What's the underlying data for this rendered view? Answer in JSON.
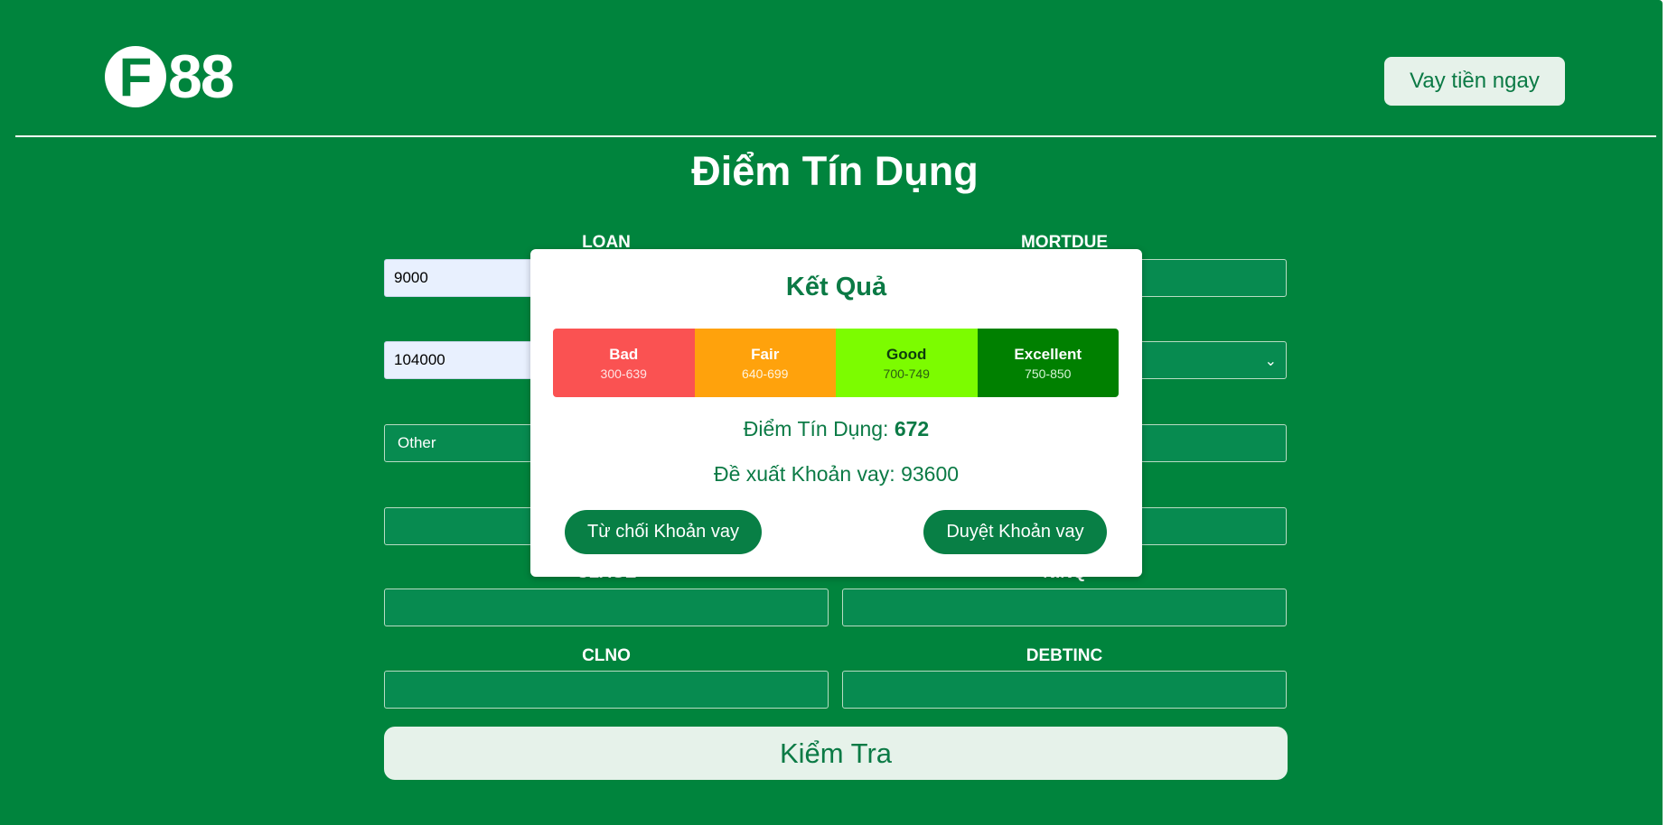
{
  "header": {
    "logo_letter": "F",
    "logo_number": "88",
    "cta_label": "Vay tiền ngay"
  },
  "page_title": "Điểm Tín Dụng",
  "form": {
    "fields": [
      {
        "label": "LOAN",
        "value": "9000"
      },
      {
        "label": "MORTDUE",
        "value": ""
      },
      {
        "label": "",
        "value": "104000"
      },
      {
        "label": "",
        "value": ""
      },
      {
        "label": "",
        "value": "Other"
      },
      {
        "label": "",
        "value": ""
      },
      {
        "label": "",
        "value": ""
      },
      {
        "label": "",
        "value": ""
      },
      {
        "label": "CLAGE",
        "value": ""
      },
      {
        "label": "NINQ",
        "value": ""
      },
      {
        "label": "CLNO",
        "value": ""
      },
      {
        "label": "DEBTINC",
        "value": ""
      }
    ],
    "submit_label": "Kiểm Tra"
  },
  "modal": {
    "title": "Kết Quả",
    "scale": [
      {
        "name": "Bad",
        "range": "300-639",
        "color": "#fa5252",
        "text_color": "#ffffff",
        "range_color": "#ffe3e3"
      },
      {
        "name": "Fair",
        "range": "640-699",
        "color": "#ffa20c",
        "text_color": "#ffffff",
        "range_color": "#fff4de"
      },
      {
        "name": "Good",
        "range": "700-749",
        "color": "#7cfc00",
        "text_color": "#0d3b0d",
        "range_color": "#2b5d12"
      },
      {
        "name": "Excellent",
        "range": "750-850",
        "color": "#008000",
        "text_color": "#ffffff",
        "range_color": "#d6f5d6"
      }
    ],
    "score_label": "Điểm Tín Dụng:",
    "score_value": "672",
    "suggestion_text": "Đề xuất Khoản vay: 93600",
    "reject_label": "Từ chối Khoản vay",
    "approve_label": "Duyệt Khoản vay"
  }
}
